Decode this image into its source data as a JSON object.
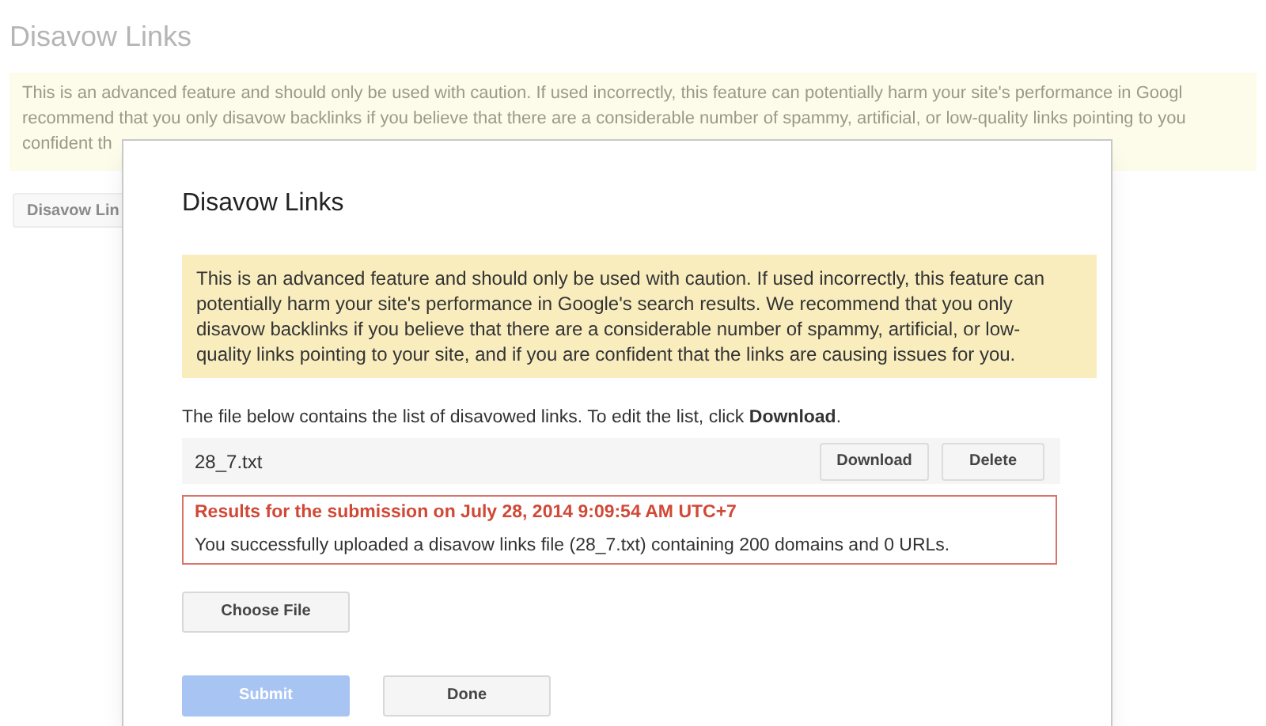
{
  "page": {
    "title": "Disavow Links",
    "warning_lines": [
      "This is an advanced feature and should only be used with caution. If used incorrectly, this feature can potentially harm your site's performance in Googl",
      "recommend that you only disavow backlinks if you believe that there are a considerable number of spammy, artificial, or low-quality links pointing to you",
      "confident th"
    ],
    "button": "Disavow Lin"
  },
  "dialog": {
    "title": "Disavow Links",
    "warning": "This is an advanced feature and should only be used with caution. If used incorrectly, this feature can potentially harm your site's performance in Google's search results. We recommend that you only disavow backlinks if you believe that there are a considerable number of spammy, artificial, or low-quality links pointing to your site, and if you are confident that the links are causing issues for you.",
    "instructions": "The file below contains the list of disavowed links. To edit the list, click **Download**.",
    "file_name": "28_7.txt",
    "file_buttons": [
      "Download",
      "Delete"
    ],
    "result_title": "Results for the submission on July 28, 2014 9:09:54 AM UTC+7",
    "result_message": "You successfully uploaded a disavow links file (28_7.txt) containing 200 domains and 0 URLs.",
    "choose_file": "Choose File",
    "actions": [
      {
        "label": "Submit",
        "kind": "primary",
        "disabled": true
      },
      {
        "label": "Done",
        "kind": "secondary",
        "disabled": false
      }
    ]
  }
}
